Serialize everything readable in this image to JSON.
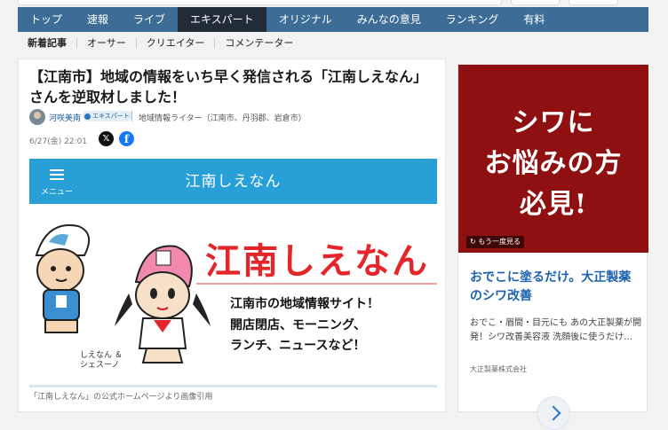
{
  "nav": {
    "items": [
      {
        "label": "トップ"
      },
      {
        "label": "速報"
      },
      {
        "label": "ライブ"
      },
      {
        "label": "エキスパート",
        "active": true
      },
      {
        "label": "オリジナル"
      },
      {
        "label": "みんなの意見"
      },
      {
        "label": "ランキング"
      },
      {
        "label": "有料"
      }
    ]
  },
  "subnav": {
    "items": [
      "新着記事",
      "オーサー",
      "クリエイター",
      "コメンテーター"
    ]
  },
  "article": {
    "headline": "【江南市】地域の情報をいち早く発信される「江南しえなん」さんを逆取材しました！",
    "author": "河咲美南",
    "badge": "エキスパート",
    "role": "地域情報ライター（江南市、丹羽郡、岩倉市）",
    "date": "6/27(金) 22:01",
    "share_x_icon": "x-icon",
    "share_fb_icon": "facebook-icon",
    "figure": {
      "menu_label": "メニュー",
      "site_title": "江南しえなん",
      "logo": "江南しえなん",
      "lines": [
        "江南市の地域情報サイト！",
        "開店閉店、モーニング、",
        "ランチ、ニュースなど！"
      ],
      "character_names": [
        "しえなん ＆",
        "シェスーノ"
      ]
    },
    "caption": "「江南しえなん」の公式ホームページより画像引用"
  },
  "ad": {
    "banner_lines": [
      "シワに",
      "お悩みの方",
      "必見!"
    ],
    "replay": "もう一度見る",
    "title": "おでこに塗るだけ。大正製薬のシワ改善",
    "body": "おでこ・眉間・目元にも あの大正製薬が開発！シワ改善美容液 洗顔後に使うだけ…",
    "sponsor": "大正製薬株式会社"
  },
  "colors": {
    "nav_bg": "#3d6d96",
    "nav_active": "#222c36",
    "link": "#1b5c99",
    "figure_bar": "#28a0d7",
    "logo_red": "#e4262b",
    "ad_banner": "#8e1010",
    "ad_title": "#1e63b0"
  }
}
